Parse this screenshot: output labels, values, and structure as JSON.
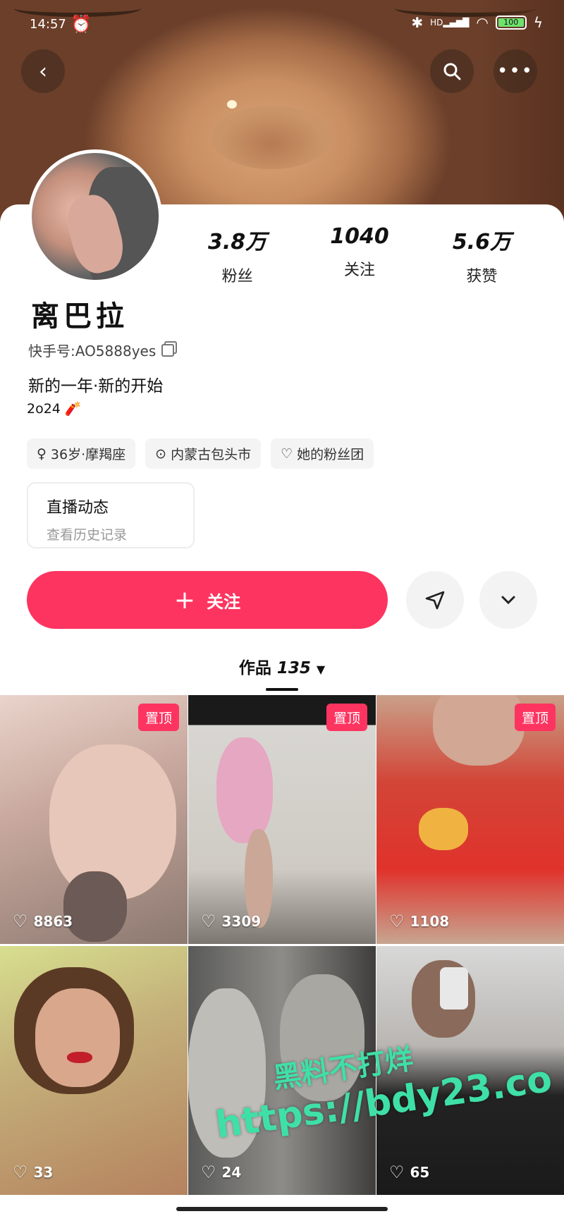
{
  "status_bar": {
    "time": "14:57",
    "network": "HD",
    "battery": "100"
  },
  "profile": {
    "name": "离巴拉",
    "kuaishou_id": "快手号:AO5888yes",
    "bio": "新的一年·新的开始",
    "bio_line2": "2o24",
    "tags": [
      "36岁·摩羯座",
      "内蒙古包头市",
      "她的粉丝团"
    ]
  },
  "stats": [
    {
      "value": "3.8万",
      "label": "粉丝"
    },
    {
      "value": "1040",
      "label": "关注"
    },
    {
      "value": "5.6万",
      "label": "获赞"
    }
  ],
  "live_card": {
    "title": "直播动态",
    "subtitle": "查看历史记录"
  },
  "actions": {
    "follow_label": "关注",
    "accent": "#fe3460"
  },
  "works": {
    "label": "作品",
    "count": "135"
  },
  "grid": [
    {
      "likes": "8863",
      "pinned": "置顶"
    },
    {
      "likes": "3309",
      "pinned": "置顶"
    },
    {
      "likes": "1108",
      "pinned": "置顶"
    },
    {
      "likes": "33",
      "pinned": ""
    },
    {
      "likes": "24",
      "pinned": ""
    },
    {
      "likes": "65",
      "pinned": ""
    }
  ],
  "watermark": {
    "line1": "黑料不打烊",
    "line2": "https://bdy23.co"
  }
}
